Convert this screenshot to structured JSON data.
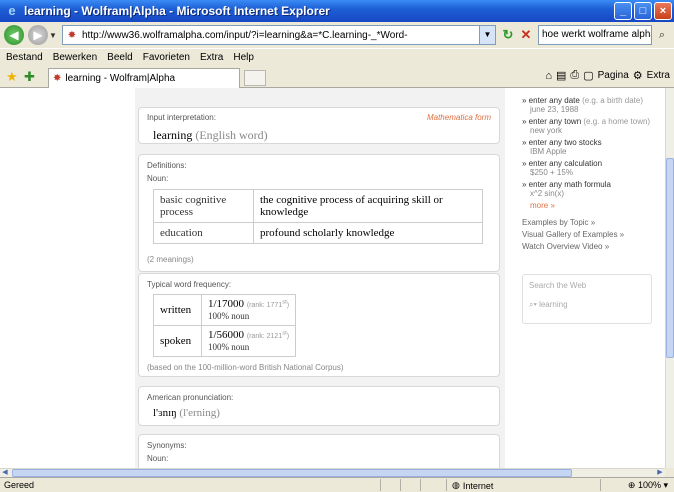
{
  "window": {
    "title": "learning - Wolfram|Alpha - Microsoft Internet Explorer"
  },
  "address": {
    "url": "http://www36.wolframalpha.com/input/?i=learning&a=*C.learning-_*Word-",
    "search_value": "hoe werkt wolframe alpha"
  },
  "menu": {
    "items": [
      "Bestand",
      "Bewerken",
      "Beeld",
      "Favorieten",
      "Extra",
      "Help"
    ]
  },
  "tabs": {
    "active_label": "learning - Wolfram|Alpha",
    "page_label": "Pagina",
    "extra_label": "Extra"
  },
  "pods": {
    "input": {
      "title": "Input interpretation:",
      "math_form": "Mathematica form",
      "word": "learning",
      "gloss": "(English word)"
    },
    "definitions": {
      "title": "Definitions:",
      "sub": "Noun:",
      "rows": [
        {
          "term": "basic cognitive process",
          "def": "the cognitive process of acquiring skill or knowledge"
        },
        {
          "term": "education",
          "def": "profound scholarly knowledge"
        }
      ],
      "note": "(2 meanings)"
    },
    "frequency": {
      "title": "Typical word frequency:",
      "rows": [
        {
          "label": "written",
          "fraction": "1/17000",
          "rank": "(rank: 1771",
          "rank_sup": "st",
          "rank_end": ")",
          "noun": "100% noun"
        },
        {
          "label": "spoken",
          "fraction": "1/56000",
          "rank": "(rank: 2121",
          "rank_sup": "st",
          "rank_end": ")",
          "noun": "100% noun"
        }
      ],
      "note": "(based on the 100-million-word British National Corpus)"
    },
    "pronunciation": {
      "title": "American pronunciation:",
      "ipa": "l'ɜnɪŋ",
      "respell": "(l'erning)"
    },
    "synonyms": {
      "title": "Synonyms:",
      "sub": "Noun:"
    }
  },
  "sidebar": {
    "items": [
      {
        "label": "enter any date",
        "hint": "(e.g. a birth date)",
        "ex": "june 23, 1988"
      },
      {
        "label": "enter any town",
        "hint": "(e.g. a home town)",
        "ex": "new york"
      },
      {
        "label": "enter any two stocks",
        "hint": "",
        "ex": "IBM Apple"
      },
      {
        "label": "enter any calculation",
        "hint": "",
        "ex": "$250 + 15%"
      },
      {
        "label": "enter any math formula",
        "hint": "",
        "ex": "x^2 sin(x)"
      }
    ],
    "more": "more »",
    "links": [
      "Examples by Topic »",
      "Visual Gallery of Examples »",
      "Watch Overview Video »"
    ],
    "search_title": "Search the Web",
    "search_query": "learning"
  },
  "status": {
    "left": "Gereed",
    "zone": "Internet",
    "zoom": "100%"
  }
}
